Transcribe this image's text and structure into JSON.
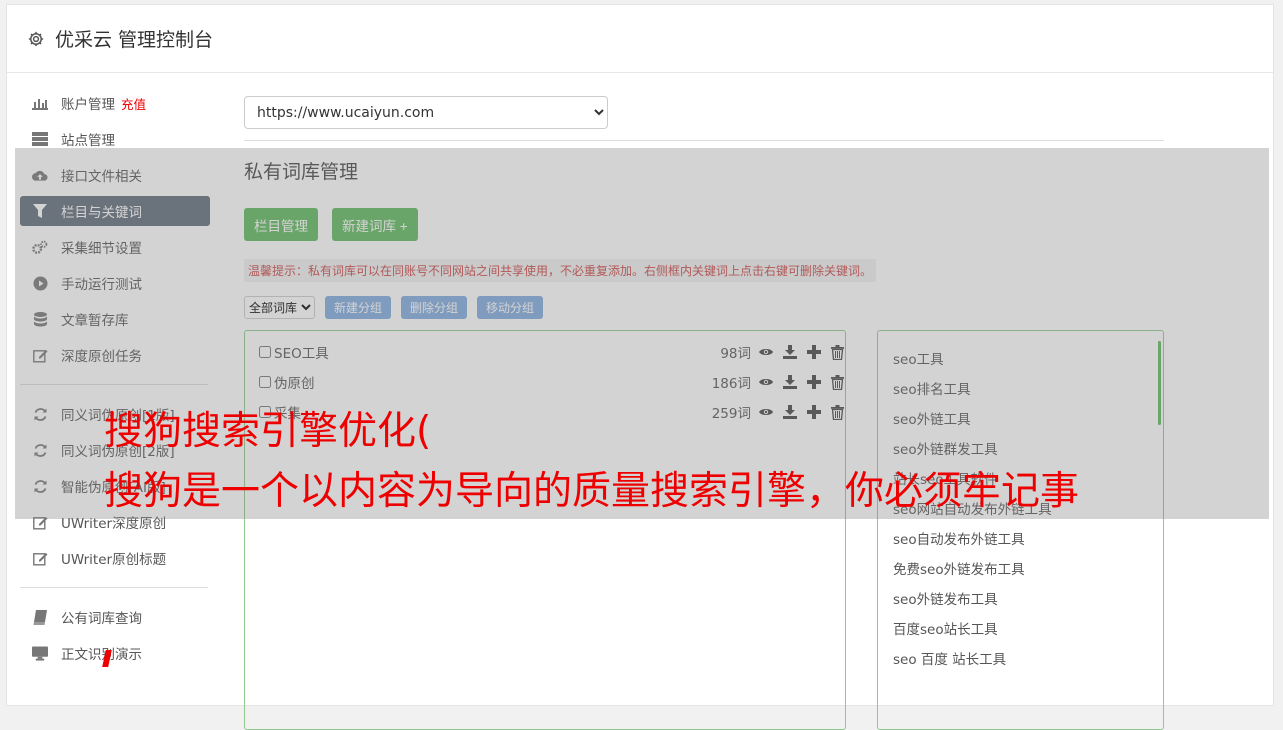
{
  "header": {
    "title": "优采云 管理控制台"
  },
  "sidebar": {
    "group1": [
      {
        "label": "账户管理",
        "extra": "充值",
        "icon": "bar-chart-icon"
      },
      {
        "label": "站点管理",
        "icon": "server-icon"
      },
      {
        "label": "接口文件相关",
        "icon": "cloud-upload-icon"
      },
      {
        "label": "栏目与关键词",
        "icon": "filter-icon",
        "active": true
      },
      {
        "label": "采集细节设置",
        "icon": "gears-icon"
      },
      {
        "label": "手动运行测试",
        "icon": "play-icon"
      },
      {
        "label": "文章暂存库",
        "icon": "database-icon"
      },
      {
        "label": "深度原创任务",
        "icon": "edit-icon"
      }
    ],
    "group2": [
      {
        "label": "同义词伪原创[1版]",
        "icon": "refresh-icon"
      },
      {
        "label": "同义词伪原创[2版]",
        "icon": "refresh-icon"
      },
      {
        "label": "智能伪原创[AI版]",
        "icon": "refresh-icon"
      },
      {
        "label": "UWriter深度原创",
        "icon": "edit-icon"
      },
      {
        "label": "UWriter原创标题",
        "icon": "edit-icon"
      }
    ],
    "group3": [
      {
        "label": "公有词库查询",
        "icon": "book-icon"
      },
      {
        "label": "正文识别演示",
        "icon": "monitor-icon"
      }
    ]
  },
  "main": {
    "site_selected": "https://www.ucaiyun.com",
    "page_title": "私有词库管理",
    "btn_columns": "栏目管理",
    "btn_new_lib": "新建词库 +",
    "tip": "温馨提示：私有词库可以在同账号不同网站之间共享使用，不必重复添加。右侧框内关键词上点击右键可删除关键词。",
    "filter_selected": "全部词库",
    "btn_new_group": "新建分组",
    "btn_delete_group": "删除分组",
    "btn_move_group": "移动分组",
    "libraries": [
      {
        "name": "SEO工具",
        "count": "98词"
      },
      {
        "name": "伪原创",
        "count": "186词"
      },
      {
        "name": "采集",
        "count": "259词"
      }
    ],
    "keywords": [
      "seo工具",
      "seo排名工具",
      "seo外链工具",
      "seo外链群发工具",
      "站长seo工具软件",
      "seo网站自动发布外链工具",
      "seo自动发布外链工具",
      "免费seo外链发布工具",
      "seo外链发布工具",
      "百度seo站长工具",
      "seo 百度 站长工具"
    ]
  },
  "overlay": {
    "line1": "搜狗搜索引擎优化(",
    "line2": "搜狗是一个以内容为导向的质量搜索引擎，你必须牢记事"
  },
  "colors": {
    "active_nav": "#5f6b7a",
    "green_button": "#5cb85c",
    "blue_button": "#7fa9de",
    "overlay_text": "#ee0000",
    "recharge": "#e00000"
  }
}
